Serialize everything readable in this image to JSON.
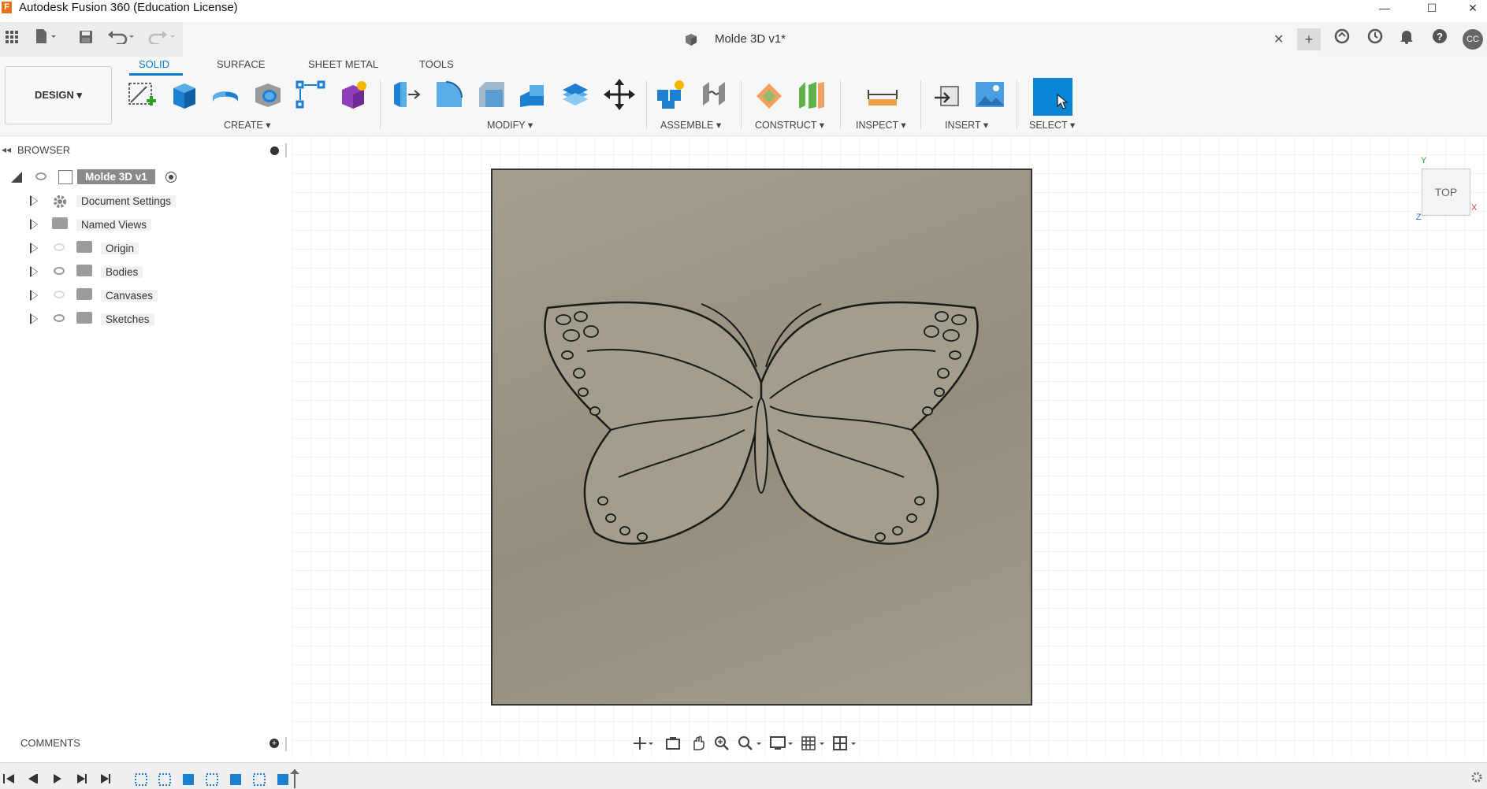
{
  "window": {
    "title": "Autodesk Fusion 360 (Education License)",
    "logo_letter": "F",
    "minimize": "—",
    "maximize": "☐",
    "close": "✕"
  },
  "doc_tab": {
    "title": "Molde 3D v1*",
    "close": "✕",
    "user_initials": "CC"
  },
  "workspace": {
    "label": "DESIGN ▾"
  },
  "ribbon_tabs": [
    "SOLID",
    "SURFACE",
    "SHEET METAL",
    "TOOLS"
  ],
  "groups": {
    "create": "CREATE ▾",
    "modify": "MODIFY ▾",
    "assemble": "ASSEMBLE ▾",
    "construct": "CONSTRUCT ▾",
    "inspect": "INSPECT ▾",
    "insert": "INSERT ▾",
    "select": "SELECT ▾"
  },
  "browser": {
    "title": "BROWSER",
    "root": "Molde 3D v1",
    "items": [
      {
        "label": "Document Settings",
        "icon": "gear-icon",
        "visible": null
      },
      {
        "label": "Named Views",
        "icon": "folder-icon",
        "visible": null
      },
      {
        "label": "Origin",
        "icon": "folder-icon",
        "visible": false
      },
      {
        "label": "Bodies",
        "icon": "folder-icon",
        "visible": true
      },
      {
        "label": "Canvases",
        "icon": "folder-icon",
        "visible": false
      },
      {
        "label": "Sketches",
        "icon": "folder-icon",
        "visible": true
      }
    ]
  },
  "viewcube": {
    "face": "TOP",
    "axis_x": "X",
    "axis_y": "Y",
    "axis_z": "Z"
  },
  "comments": {
    "title": "COMMENTS"
  },
  "colors": {
    "accent": "#0b79c7",
    "select_button": "#0a85d6",
    "mold_surface": "#9b9584"
  }
}
